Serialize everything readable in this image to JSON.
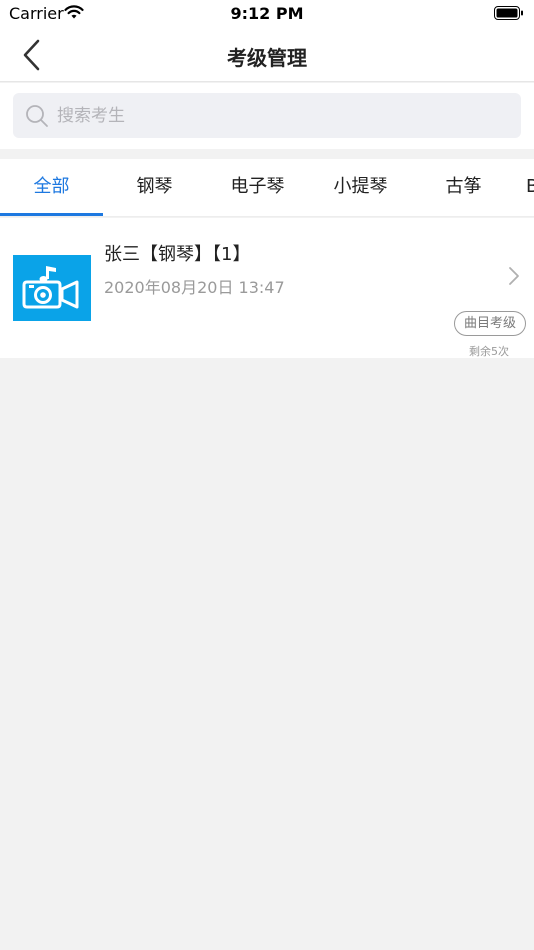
{
  "status_bar": {
    "carrier": "Carrier",
    "time": "9:12 PM"
  },
  "nav": {
    "title": "考级管理",
    "back_icon": "chevron-left-icon"
  },
  "search": {
    "placeholder": "搜索考生",
    "value": ""
  },
  "tabs": [
    {
      "label": "全部",
      "active": true
    },
    {
      "label": "钢琴"
    },
    {
      "label": "电子琴"
    },
    {
      "label": "小提琴"
    },
    {
      "label": "古筝"
    },
    {
      "label": "B"
    }
  ],
  "list": [
    {
      "title": "张三【钢琴】【1】",
      "date": "2020年08月20日 13:47",
      "tag": "曲目考级",
      "remaining": "剩余5次",
      "thumb_icon": "video-camera-music-icon",
      "thumb_color": "#0aa3e8"
    }
  ],
  "colors": {
    "accent": "#1d78e0",
    "background": "#f2f2f2"
  }
}
